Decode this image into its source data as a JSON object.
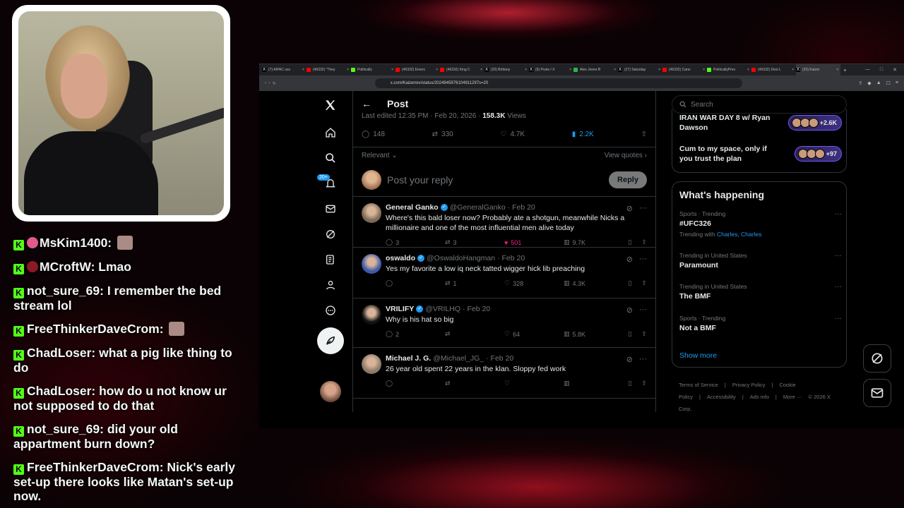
{
  "chat": [
    {
      "user": "MsKim1400:",
      "message": "",
      "badge_color": "#e15a8e",
      "has_emote": true
    },
    {
      "user": "MCroftW:",
      "message": "Lmao",
      "badge_color": "#8a1a24",
      "has_emote": false
    },
    {
      "user": "not_sure_69:",
      "message": "I remember the bed stream lol",
      "badge_color": "",
      "has_emote": false
    },
    {
      "user": "FreeThinkerDaveCrom:",
      "message": "",
      "badge_color": "",
      "has_emote": true
    },
    {
      "user": "ChadLoser:",
      "message": "what a pig like thing to do",
      "badge_color": "",
      "has_emote": false
    },
    {
      "user": "ChadLoser:",
      "message": "how do u not know ur not supposed to do that",
      "badge_color": "",
      "has_emote": false
    },
    {
      "user": "not_sure_69:",
      "message": "did your old appartment burn down?",
      "badge_color": "",
      "has_emote": false
    },
    {
      "user": "FreeThinkerDaveCrom:",
      "message": "Nick's early set-up there looks like Matan's set-up now.",
      "badge_color": "",
      "has_emote": false
    }
  ],
  "browser": {
    "tabs": [
      {
        "label": "(7) AIPAC uss",
        "icon": "x",
        "color": "#000"
      },
      {
        "label": "(46332) \"They",
        "icon": "yt",
        "color": "#ff0000"
      },
      {
        "label": "Politically",
        "icon": "k",
        "color": "#53fc18"
      },
      {
        "label": "(46332) Emerc",
        "icon": "yt",
        "color": "#ff0000"
      },
      {
        "label": "(46332) King C",
        "icon": "yt",
        "color": "#ff0000"
      },
      {
        "label": "(20) Brittany",
        "icon": "x",
        "color": "#000"
      },
      {
        "label": "(9) Posts / X",
        "icon": "x",
        "color": "#000"
      },
      {
        "label": "Alex Jones B",
        "icon": "play",
        "color": "#2fb34a"
      },
      {
        "label": "(27) Saturday",
        "icon": "x",
        "color": "#000"
      },
      {
        "label": "(46332) Cano",
        "icon": "yt",
        "color": "#ff0000"
      },
      {
        "label": "PoliticallyPrev",
        "icon": "k",
        "color": "#53fc18"
      },
      {
        "label": "(46332) Desi L",
        "icon": "yt",
        "color": "#ff0000"
      },
      {
        "label": "(20) Kaizer",
        "icon": "x",
        "color": "#000",
        "active": true
      }
    ],
    "url": "x.com/Kaizerrev/status/2024945976104911297s=20"
  },
  "x": {
    "header_title": "Post",
    "edited_prefix": "Last edited 12:35 PM · Feb 20, 2026 · ",
    "views_count": "158.3K",
    "views_label": " Views",
    "stats": {
      "replies": "148",
      "reposts": "330",
      "likes": "4.7K",
      "bookmarks": "2.2K"
    },
    "relevant_label": "Relevant",
    "view_quotes_label": "View quotes",
    "reply_placeholder": "Post your reply",
    "reply_button": "Reply",
    "notif_badge": "20+",
    "replies": [
      {
        "name": "General Ganko",
        "handle": "@GeneralGanko",
        "date": "· Feb 20",
        "verified": true,
        "text": "Where's this bald loser now?  Probably ate a shotgun, meanwhile Nicks a millionaire and one of the most influential men alive today",
        "replies": "3",
        "reposts": "3",
        "likes": "501",
        "views": "9.7K",
        "liked": true,
        "avatar_color": "#7a6a55"
      },
      {
        "name": "oswaldo",
        "handle": "@OswaldoHangman",
        "date": "· Feb 20",
        "verified": true,
        "text": "Yes my favorite a low iq neck tatted wigger hick lib preaching",
        "replies": "",
        "reposts": "1",
        "likes": "328",
        "views": "4.3K",
        "liked": false,
        "avatar_color": "#3b5aa8"
      },
      {
        "name": "VRILIFY",
        "handle": "@VRILHQ",
        "date": "· Feb 20",
        "verified": true,
        "text": "Why is his hat so big",
        "replies": "2",
        "reposts": "",
        "likes": "64",
        "views": "5.8K",
        "liked": false,
        "avatar_color": "#111111"
      },
      {
        "name": "Michael J. G.",
        "handle": "@Michael_JG_",
        "date": "· Feb 20",
        "verified": false,
        "text": "26 year old spent 22 years in the klan. Sloppy fed work",
        "replies": "",
        "reposts": "",
        "likes": "",
        "views": "",
        "liked": false,
        "avatar_color": "#8a7a6a"
      }
    ],
    "search_placeholder": "Search",
    "spaces": [
      {
        "title": "IRAN WAR DAY 8 w/ Ryan Dawson",
        "count": "+2.6K"
      },
      {
        "title": "Cum to my space, only if you trust the plan",
        "count": "+97"
      }
    ],
    "happening_title": "What's happening",
    "trends": [
      {
        "meta": "Sports · Trending",
        "name": "#UFC326",
        "with_prefix": "Trending with",
        "with_names": "Charles, Charles"
      },
      {
        "meta": "Trending in United States",
        "name": "Paramount"
      },
      {
        "meta": "Trending in United States",
        "name": "The BMF"
      },
      {
        "meta": "Sports · Trending",
        "name": "Not a BMF"
      }
    ],
    "show_more": "Show more",
    "footer": [
      "Terms of Service",
      "|",
      "Privacy Policy",
      "|",
      "Cookie Policy",
      "|",
      "Accessibility",
      "|",
      "Ads info",
      "|",
      "More ···",
      "© 2026 X Corp."
    ]
  }
}
